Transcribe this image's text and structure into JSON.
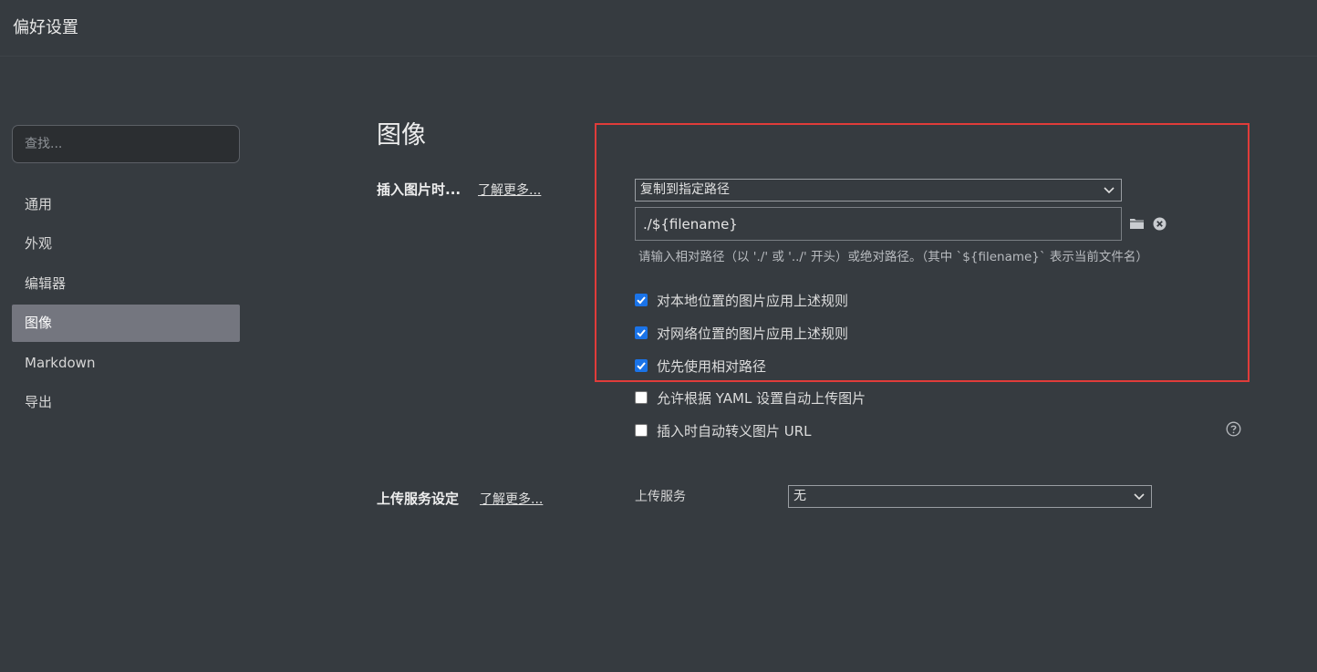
{
  "window": {
    "title": "偏好设置"
  },
  "search": {
    "placeholder": "查找..."
  },
  "sidebar": {
    "items": [
      {
        "label": "通用"
      },
      {
        "label": "外观"
      },
      {
        "label": "编辑器"
      },
      {
        "label": "图像",
        "active": true
      },
      {
        "label": "Markdown"
      },
      {
        "label": "导出"
      }
    ]
  },
  "main": {
    "section_title": "图像",
    "insert": {
      "label": "插入图片时...",
      "learn_more": "了解更多...",
      "action_select": "复制到指定路径",
      "path_value": "./${filename}",
      "hint": "请输入相对路径（以 './' 或 '../' 开头）或绝对路径。（其中 `${filename}` 表示当前文件名）",
      "options": [
        {
          "label": "对本地位置的图片应用上述规则",
          "checked": true
        },
        {
          "label": "对网络位置的图片应用上述规则",
          "checked": true
        },
        {
          "label": "优先使用相对路径",
          "checked": true
        },
        {
          "label": "允许根据 YAML 设置自动上传图片",
          "checked": false
        },
        {
          "label": "插入时自动转义图片 URL",
          "checked": false
        }
      ]
    },
    "upload": {
      "label": "上传服务设定",
      "learn_more": "了解更多...",
      "service_label": "上传服务",
      "service_select": "无"
    }
  },
  "colors": {
    "background": "#363b40",
    "active_nav": "#74767f",
    "highlight_border": "#e03c3a",
    "checkbox_accent": "#1a73e8"
  }
}
